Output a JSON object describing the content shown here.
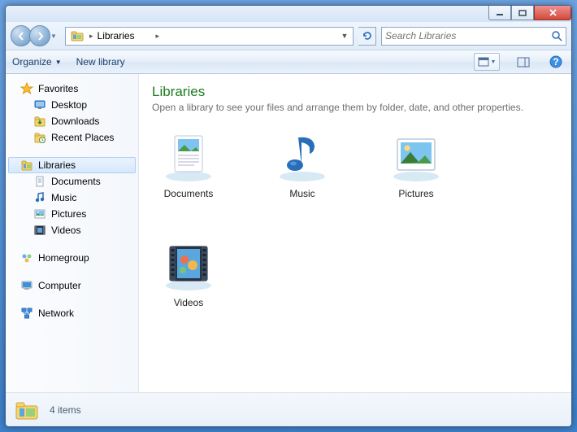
{
  "breadcrumb": {
    "root": "Libraries",
    "sep": "▸",
    "sep2": "▸"
  },
  "search": {
    "placeholder": "Search Libraries"
  },
  "toolbar": {
    "organize": "Organize",
    "newlib": "New library"
  },
  "sidebar": {
    "favorites": {
      "label": "Favorites",
      "items": [
        "Desktop",
        "Downloads",
        "Recent Places"
      ]
    },
    "libraries": {
      "label": "Libraries",
      "items": [
        "Documents",
        "Music",
        "Pictures",
        "Videos"
      ]
    },
    "homegroup": {
      "label": "Homegroup"
    },
    "computer": {
      "label": "Computer"
    },
    "network": {
      "label": "Network"
    }
  },
  "content": {
    "title": "Libraries",
    "subtitle": "Open a library to see your files and arrange them by folder, date, and other properties.",
    "items": [
      "Documents",
      "Music",
      "Pictures",
      "Videos"
    ]
  },
  "status": {
    "count": "4 items"
  }
}
